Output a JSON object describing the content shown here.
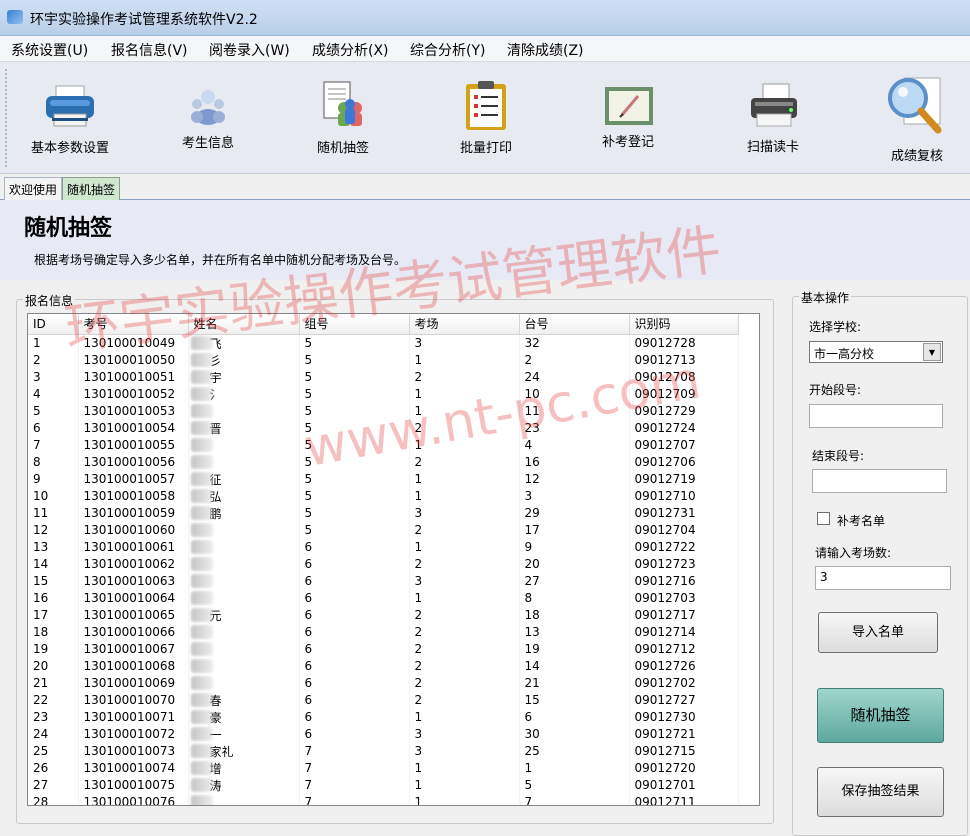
{
  "window": {
    "title": "环宇实验操作考试管理系统软件V2.2"
  },
  "menu": [
    {
      "label": "系统设置(U)"
    },
    {
      "label": "报名信息(V)"
    },
    {
      "label": "阅卷录入(W)"
    },
    {
      "label": "成绩分析(X)"
    },
    {
      "label": "综合分析(Y)"
    },
    {
      "label": "清除成绩(Z)"
    }
  ],
  "toolbar": [
    {
      "label": "基本参数设置",
      "icon": "printer-icon"
    },
    {
      "label": "考生信息",
      "icon": "users-icon"
    },
    {
      "label": "随机抽签",
      "icon": "draw-lots-icon"
    },
    {
      "label": "批量打印",
      "icon": "clipboard-list-icon"
    },
    {
      "label": "补考登记",
      "icon": "register-edit-icon"
    },
    {
      "label": "扫描读卡",
      "icon": "scanner-icon"
    },
    {
      "label": "成绩复核",
      "icon": "magnifier-icon"
    }
  ],
  "tabs": [
    {
      "label": "欢迎使用"
    },
    {
      "label": "随机抽签"
    }
  ],
  "page": {
    "title": "随机抽签",
    "description": "根据考场号确定导入多少名单，并在所有名单中随机分配考场及台号。"
  },
  "registration": {
    "group_title": "报名信息",
    "columns": [
      "ID",
      "考号",
      "姓名",
      "组号",
      "考场",
      "台号",
      "识别码"
    ],
    "rows": [
      [
        "1",
        "130100010049",
        "飞",
        "5",
        "3",
        "32",
        "09012728"
      ],
      [
        "2",
        "130100010050",
        "彡",
        "5",
        "1",
        "2",
        "09012713"
      ],
      [
        "3",
        "130100010051",
        "宇",
        "5",
        "2",
        "24",
        "09012708"
      ],
      [
        "4",
        "130100010052",
        "氵",
        "5",
        "1",
        "10",
        "09012709"
      ],
      [
        "5",
        "130100010053",
        "",
        "5",
        "1",
        "11",
        "09012729"
      ],
      [
        "6",
        "130100010054",
        "晋",
        "5",
        "2",
        "23",
        "09012724"
      ],
      [
        "7",
        "130100010055",
        "",
        "5",
        "1",
        "4",
        "09012707"
      ],
      [
        "8",
        "130100010056",
        "",
        "5",
        "2",
        "16",
        "09012706"
      ],
      [
        "9",
        "130100010057",
        "征",
        "5",
        "1",
        "12",
        "09012719"
      ],
      [
        "10",
        "130100010058",
        "弘",
        "5",
        "1",
        "3",
        "09012710"
      ],
      [
        "11",
        "130100010059",
        "鹏",
        "5",
        "3",
        "29",
        "09012731"
      ],
      [
        "12",
        "130100010060",
        "",
        "5",
        "2",
        "17",
        "09012704"
      ],
      [
        "13",
        "130100010061",
        "",
        "6",
        "1",
        "9",
        "09012722"
      ],
      [
        "14",
        "130100010062",
        "",
        "6",
        "2",
        "20",
        "09012723"
      ],
      [
        "15",
        "130100010063",
        "",
        "6",
        "3",
        "27",
        "09012716"
      ],
      [
        "16",
        "130100010064",
        "",
        "6",
        "1",
        "8",
        "09012703"
      ],
      [
        "17",
        "130100010065",
        "元",
        "6",
        "2",
        "18",
        "09012717"
      ],
      [
        "18",
        "130100010066",
        "",
        "6",
        "2",
        "13",
        "09012714"
      ],
      [
        "19",
        "130100010067",
        "",
        "6",
        "2",
        "19",
        "09012712"
      ],
      [
        "20",
        "130100010068",
        "",
        "6",
        "2",
        "14",
        "09012726"
      ],
      [
        "21",
        "130100010069",
        "",
        "6",
        "2",
        "21",
        "09012702"
      ],
      [
        "22",
        "130100010070",
        "春",
        "6",
        "2",
        "15",
        "09012727"
      ],
      [
        "23",
        "130100010071",
        "豪",
        "6",
        "1",
        "6",
        "09012730"
      ],
      [
        "24",
        "130100010072",
        "一",
        "6",
        "3",
        "30",
        "09012721"
      ],
      [
        "25",
        "130100010073",
        "家礼",
        "7",
        "3",
        "25",
        "09012715"
      ],
      [
        "26",
        "130100010074",
        "增",
        "7",
        "1",
        "1",
        "09012720"
      ],
      [
        "27",
        "130100010075",
        "涛",
        "7",
        "1",
        "5",
        "09012701"
      ],
      [
        "28",
        "130100010076",
        "",
        "7",
        "1",
        "7",
        "09012711"
      ]
    ]
  },
  "ops": {
    "group_title": "基本操作",
    "school_label": "选择学校:",
    "school_value": "市一高分校",
    "start_label": "开始段号:",
    "start_value": "",
    "end_label": "结束段号:",
    "end_value": "",
    "makeup_label": "补考名单",
    "makeup_checked": false,
    "rooms_label": "请输入考场数:",
    "rooms_value": "3",
    "import_button": "导入名单",
    "draw_button": "随机抽签",
    "save_button": "保存抽签结果"
  },
  "watermark": {
    "line1": "环宇实验操作考试管理软件",
    "line2": "www.nt-pc.com"
  }
}
